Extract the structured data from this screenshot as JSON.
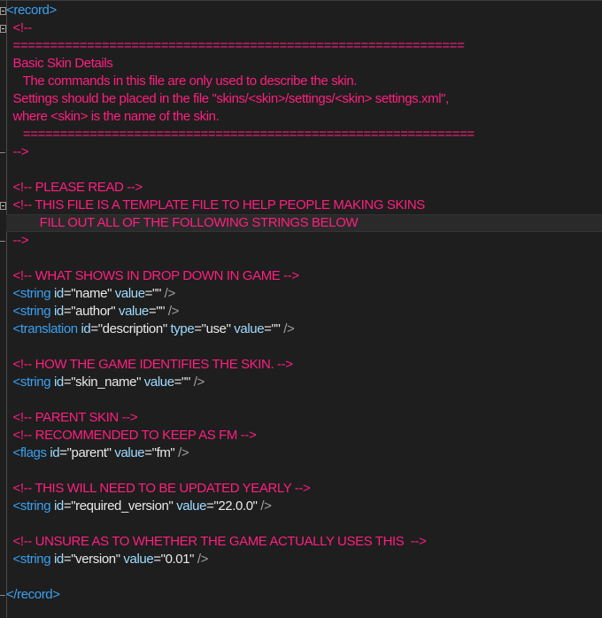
{
  "editor": {
    "l01": {
      "open": "<record>"
    },
    "l02": {
      "text": "<!--"
    },
    "l03": {
      "text": "============================================================="
    },
    "l04": {
      "text": "Basic Skin Details"
    },
    "l05": {
      "text": "   The commands in this file are only used to describe the skin."
    },
    "l06": {
      "text": "Settings should be placed in the file \"skins/<skin>/settings/<skin> settings.xml\","
    },
    "l07": {
      "text": "where <skin> is the name of the skin."
    },
    "l08": {
      "text": "   ============================================================="
    },
    "l09": {
      "text": "-->"
    },
    "l11": {
      "text": "<!-- PLEASE READ -->"
    },
    "l12": {
      "text": "<!-- THIS FILE IS A TEMPLATE FILE TO HELP PEOPLE MAKING SKINS"
    },
    "l13": {
      "text": "        FILL OUT ALL OF THE FOLLOWING STRINGS BELOW"
    },
    "l14": {
      "text": "-->"
    },
    "l16": {
      "text": "<!-- WHAT SHOWS IN DROP DOWN IN GAME -->"
    },
    "l17": {
      "tag": "<string",
      "a1": "id",
      "e1": "=",
      "v1": "\"name\"",
      "a2": "value",
      "e2": "=",
      "v2": "\"\"",
      "close": "/>"
    },
    "l18": {
      "tag": "<string",
      "a1": "id",
      "e1": "=",
      "v1": "\"author\"",
      "a2": "value",
      "e2": "=",
      "v2": "\"\"",
      "close": "/>"
    },
    "l19": {
      "tag": "<translation",
      "a1": "id",
      "e1": "=",
      "v1": "\"description\"",
      "a2": "type",
      "e2": "=",
      "v2": "\"use\"",
      "a3": "value",
      "e3": "=",
      "v3": "\"\"",
      "close": "/>"
    },
    "l21": {
      "text": "<!-- HOW THE GAME IDENTIFIES THE SKIN. -->"
    },
    "l22": {
      "tag": "<string",
      "a1": "id",
      "e1": "=",
      "v1": "\"skin_name\"",
      "a2": "value",
      "e2": "=",
      "v2": "\"\"",
      "close": "/>"
    },
    "l24": {
      "text": "<!-- PARENT SKIN -->"
    },
    "l25": {
      "text": "<!-- RECOMMENDED TO KEEP AS FM -->"
    },
    "l26": {
      "tag": "<flags",
      "a1": "id",
      "e1": "=",
      "v1": "\"parent\"",
      "a2": "value",
      "e2": "=",
      "v2": "\"fm\"",
      "close": "/>"
    },
    "l28": {
      "text": "<!-- THIS WILL NEED TO BE UPDATED YEARLY -->"
    },
    "l29": {
      "tag": "<string",
      "a1": "id",
      "e1": "=",
      "v1": "\"required_version\"",
      "a2": "value",
      "e2": "=",
      "v2": "\"22.0.0\"",
      "close": "/>"
    },
    "l31": {
      "text": "<!-- UNSURE AS TO WHETHER THE GAME ACTUALLY USES THIS  -->"
    },
    "l32": {
      "tag": "<string",
      "a1": "id",
      "e1": "=",
      "v1": "\"version\"",
      "a2": "value",
      "e2": "=",
      "v2": "\"0.01\"",
      "close": "/>"
    },
    "l34": {
      "close": "</record>"
    }
  },
  "colors": {
    "background": "#1e1e1e",
    "comment": "#ff1f7f",
    "tag": "#3aa0f0",
    "attribute": "#9edcff",
    "value": "#e8e8e8",
    "current_line": "#2a2a2a"
  }
}
